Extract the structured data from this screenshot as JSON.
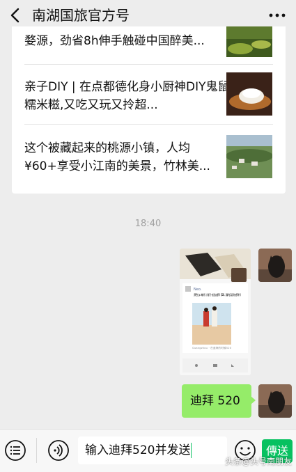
{
  "header": {
    "title": "南湖国旅官方号"
  },
  "articles": [
    {
      "title": "婺源，劲省8h伸手触碰中国醉美..."
    },
    {
      "title": "亲子DIY | 在点都德化身小厨神DIY鬼鼠糯米糍,又吃又玩又拎超..."
    },
    {
      "title": "这个被藏起来的桃源小镇，人均¥60+享受小江南的美景，竹林美..."
    }
  ],
  "timestamp": "18:40",
  "shared_screenshot": {
    "sender": "Neo.",
    "post_text": "黄色心口笔坪，陪们一起去迪拜【520，要的见证你迪拜~】",
    "caption": "Guangzhou · 在迪拜的时候520"
  },
  "message": {
    "text": "迪拜 520"
  },
  "input": {
    "value": "输入迪拜520并发送"
  },
  "send_label": "傳送",
  "watermark": "头条@头号南朋友",
  "colors": {
    "accent": "#07c160",
    "bubble": "#95ec69",
    "background": "#ededed"
  }
}
